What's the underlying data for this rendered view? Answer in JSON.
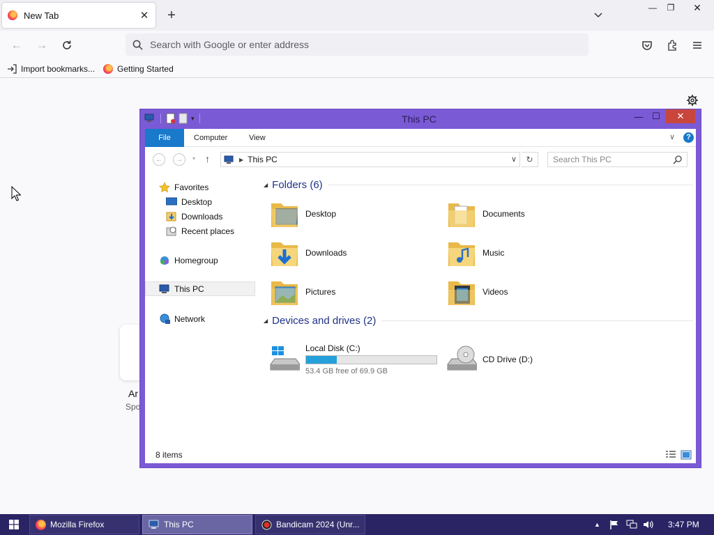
{
  "browser": {
    "tab_title": "New Tab",
    "new_tab_symbol": "+",
    "url_placeholder": "Search with Google or enter address",
    "bookmarks": [
      {
        "label": "Import bookmarks...",
        "icon": "import-icon"
      },
      {
        "label": "Getting Started",
        "icon": "firefox-icon"
      }
    ],
    "shortcut": {
      "title": "Ar",
      "subtitle": "Spo"
    }
  },
  "explorer": {
    "title": "This PC",
    "ribbon_tabs": [
      "File",
      "Computer",
      "View"
    ],
    "help_symbol": "?",
    "address": "This PC",
    "search_placeholder": "Search This PC",
    "nav": {
      "favorites": "Favorites",
      "desktop": "Desktop",
      "downloads": "Downloads",
      "recent": "Recent places",
      "homegroup": "Homegroup",
      "thispc": "This PC",
      "network": "Network"
    },
    "folders_header": "Folders (6)",
    "folders": [
      "Desktop",
      "Documents",
      "Downloads",
      "Music",
      "Pictures",
      "Videos"
    ],
    "drives_header": "Devices and drives (2)",
    "local_disk": {
      "label": "Local Disk (C:)",
      "free_text": "53.4 GB free of 69.9 GB",
      "used_fraction": 0.236
    },
    "cd_drive": {
      "label": "CD Drive (D:)"
    },
    "status": "8 items"
  },
  "taskbar": {
    "items": [
      "Mozilla Firefox",
      "This PC",
      "Bandicam 2024 (Unr..."
    ],
    "clock": "3:47 PM"
  },
  "colors": {
    "explorer_frame": "#7b5ad6",
    "file_tab": "#1979ca",
    "taskbar": "#2a2465",
    "drive_fill": "#26a0da",
    "group_header": "#1e3287"
  }
}
